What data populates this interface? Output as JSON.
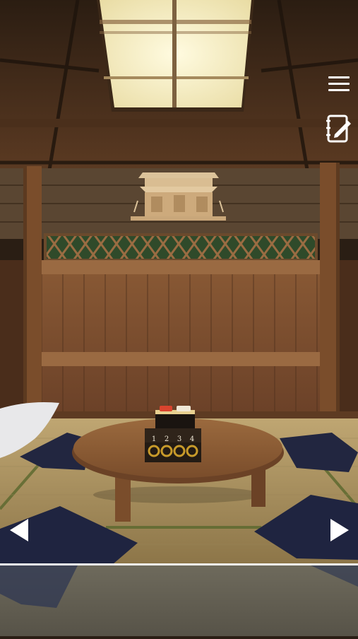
{
  "scene": {
    "name": "tatami-room",
    "lock": {
      "digits": [
        "1",
        "2",
        "3",
        "4"
      ]
    }
  },
  "hud": {
    "menu_icon": "hamburger-menu-icon",
    "memo_icon": "notepad-pencil-icon",
    "left_icon": "left-arrow-icon",
    "right_icon": "right-arrow-icon"
  },
  "colors": {
    "wood_dark": "#3a2616",
    "wood_mid": "#7a4d2b",
    "tatami": "#a68e5e",
    "cushion": "#202540",
    "table": "#8a5a34"
  }
}
